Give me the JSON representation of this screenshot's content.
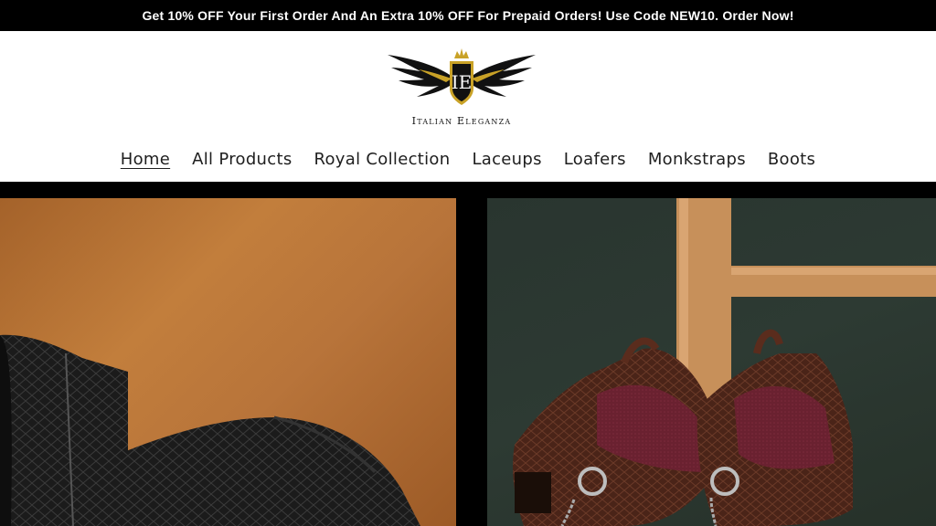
{
  "announcement": {
    "text": "Get 10% OFF Your First Order And An Extra 10% OFF For Prepaid Orders! Use Code NEW10. Order Now!"
  },
  "brand": {
    "name": "Italian Eleganza",
    "logo_monogram": "IE",
    "colors": {
      "gold": "#c9a227",
      "black": "#111111"
    }
  },
  "nav": {
    "items": [
      {
        "label": "Home",
        "active": true
      },
      {
        "label": "All Products"
      },
      {
        "label": "Royal Collection"
      },
      {
        "label": "Laceups"
      },
      {
        "label": "Loafers"
      },
      {
        "label": "Monkstraps"
      },
      {
        "label": "Boots"
      }
    ]
  },
  "hero": {
    "slides": [
      {
        "image": "black croc-embossed ankle boot on tan background"
      },
      {
        "image": "brown croc-leather boots with burgundy panels and silver harness chains"
      }
    ]
  }
}
